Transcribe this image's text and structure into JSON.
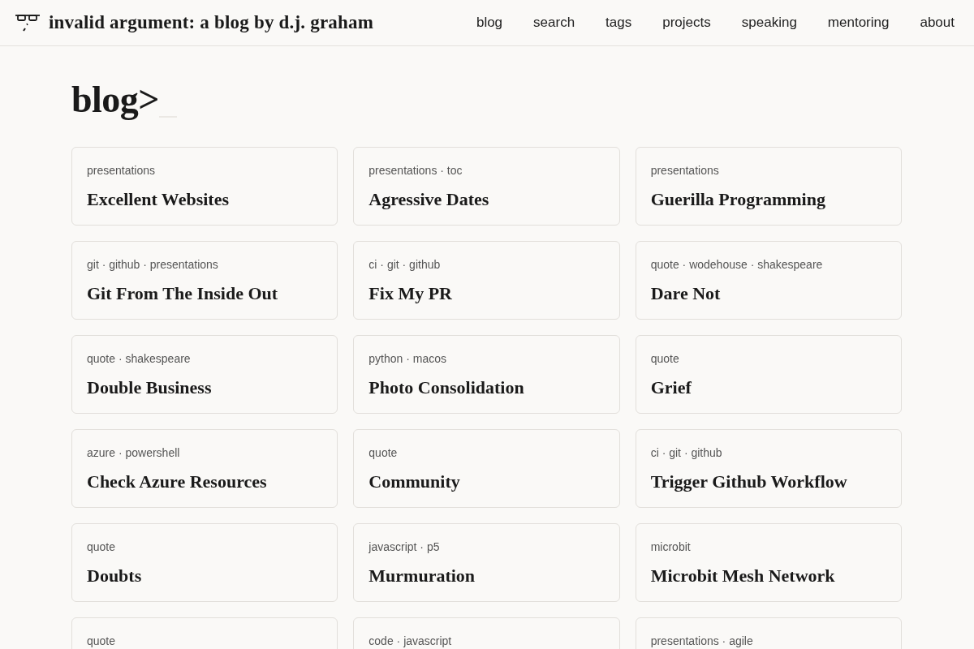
{
  "header": {
    "site_title": "invalid argument: a blog by d.j. graham",
    "nav": [
      "blog",
      "search",
      "tags",
      "projects",
      "speaking",
      "mentoring",
      "about"
    ]
  },
  "page": {
    "heading": "blog>",
    "posts": [
      {
        "tags": "presentations",
        "title": "Excellent Websites"
      },
      {
        "tags": "presentations · toc",
        "title": "Agressive Dates"
      },
      {
        "tags": "presentations",
        "title": "Guerilla Programming"
      },
      {
        "tags": "git · github · presentations",
        "title": "Git From The Inside Out"
      },
      {
        "tags": "ci · git · github",
        "title": "Fix My PR"
      },
      {
        "tags": "quote · wodehouse · shakespeare",
        "title": "Dare Not"
      },
      {
        "tags": "quote · shakespeare",
        "title": "Double Business"
      },
      {
        "tags": "python · macos",
        "title": "Photo Consolidation"
      },
      {
        "tags": "quote",
        "title": "Grief"
      },
      {
        "tags": "azure · powershell",
        "title": "Check Azure Resources"
      },
      {
        "tags": "quote",
        "title": "Community"
      },
      {
        "tags": "ci · git · github",
        "title": "Trigger Github Workflow"
      },
      {
        "tags": "quote",
        "title": "Doubts"
      },
      {
        "tags": "javascript · p5",
        "title": "Murmuration"
      },
      {
        "tags": "microbit",
        "title": "Microbit Mesh Network"
      },
      {
        "tags": "quote"
      },
      {
        "tags": "code · javascript"
      },
      {
        "tags": "presentations · agile"
      }
    ]
  }
}
